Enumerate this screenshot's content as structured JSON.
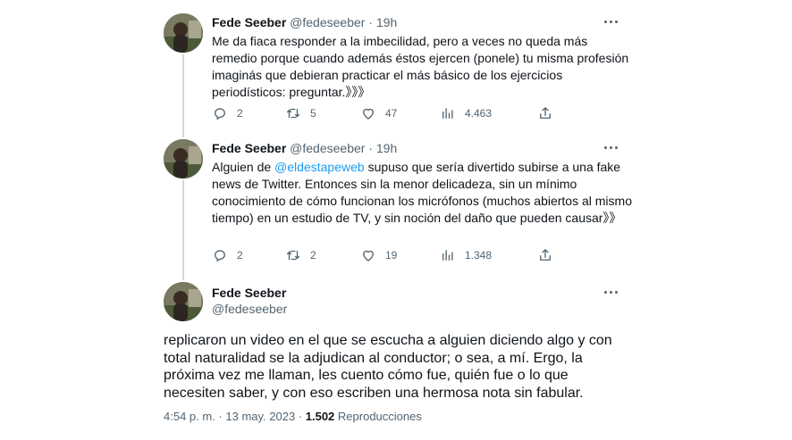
{
  "tweets": [
    {
      "name": "Fede Seeber",
      "handle": "@fedeseeber",
      "separator": "·",
      "time": "19h",
      "text": "Me da fiaca responder a la imbecilidad, pero a veces no queda más remedio porque cuando además éstos ejercen (ponele) tu misma profesión imaginás que debieran practicar el más básico de los ejercicios periodísticos: preguntar.》》》",
      "replies": "2",
      "retweets": "5",
      "likes": "47",
      "views": "4.463"
    },
    {
      "name": "Fede Seeber",
      "handle": "@fedeseeber",
      "separator": "·",
      "time": "19h",
      "text_before": "Alguien de ",
      "mention": "@eldestapeweb",
      "text_after": " supuso que sería divertido subirse a una fake news de Twitter. Entonces sin la menor delicadeza, sin un mínimo conocimiento de cómo funcionan los micrófonos (muchos abiertos al mismo tiempo) en un estudio de TV, y sin noción del daño que pueden causar》》",
      "replies": "2",
      "retweets": "2",
      "likes": "19",
      "views": "1.348"
    }
  ],
  "main_tweet": {
    "name": "Fede Seeber",
    "handle": "@fedeseeber",
    "text": "replicaron un video en el que se escucha a alguien diciendo algo y con total naturalidad se la adjudican al conductor; o sea, a mí. Ergo, la próxima vez me llaman, les cuento cómo fue, quién fue o lo que necesiten saber, y con eso escriben una hermosa nota sin fabular.",
    "time": "4:54 p. m.",
    "date_sep": " · ",
    "date": "13 may. 2023",
    "views_sep": " · ",
    "views": "1.502",
    "views_label": " Reproducciones"
  },
  "icons": {
    "reply": "reply-icon",
    "retweet": "retweet-icon",
    "like": "heart-icon",
    "views": "views-icon",
    "share": "share-icon",
    "more": "more-icon"
  },
  "colors": {
    "text": "#0f1419",
    "secondary": "#536471",
    "link": "#1d9bf0",
    "thread_line": "#cfd9de"
  }
}
